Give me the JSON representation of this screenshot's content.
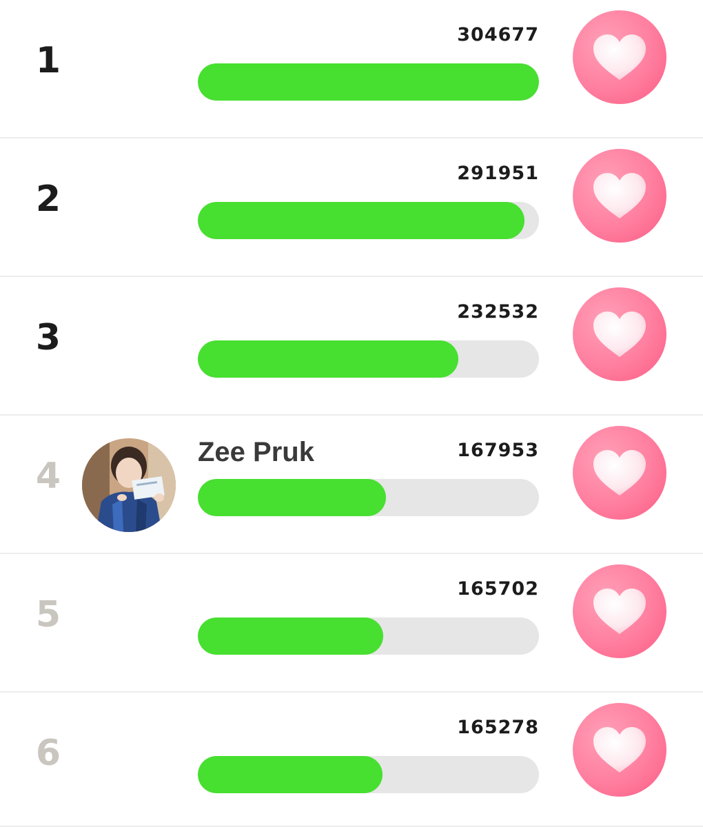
{
  "colors": {
    "bar_fill": "#47df30",
    "bar_track": "#e6e6e6",
    "heart_button": "#ff7e9f",
    "rank_top": "#1c1c1c",
    "rank_other": "#c9c5bf"
  },
  "ranking": [
    {
      "rank": "1",
      "name": "",
      "votes": "304677",
      "progress": 1.0,
      "heart_icon": "heart-icon"
    },
    {
      "rank": "2",
      "name": "",
      "votes": "291951",
      "progress": 0.958,
      "heart_icon": "heart-icon"
    },
    {
      "rank": "3",
      "name": "",
      "votes": "232532",
      "progress": 0.763,
      "heart_icon": "heart-icon"
    },
    {
      "rank": "4",
      "name": "Zee Pruk",
      "votes": "167953",
      "progress": 0.551,
      "heart_icon": "heart-icon"
    },
    {
      "rank": "5",
      "name": "",
      "votes": "165702",
      "progress": 0.544,
      "heart_icon": "heart-icon"
    },
    {
      "rank": "6",
      "name": "",
      "votes": "165278",
      "progress": 0.542,
      "heart_icon": "heart-icon"
    }
  ]
}
